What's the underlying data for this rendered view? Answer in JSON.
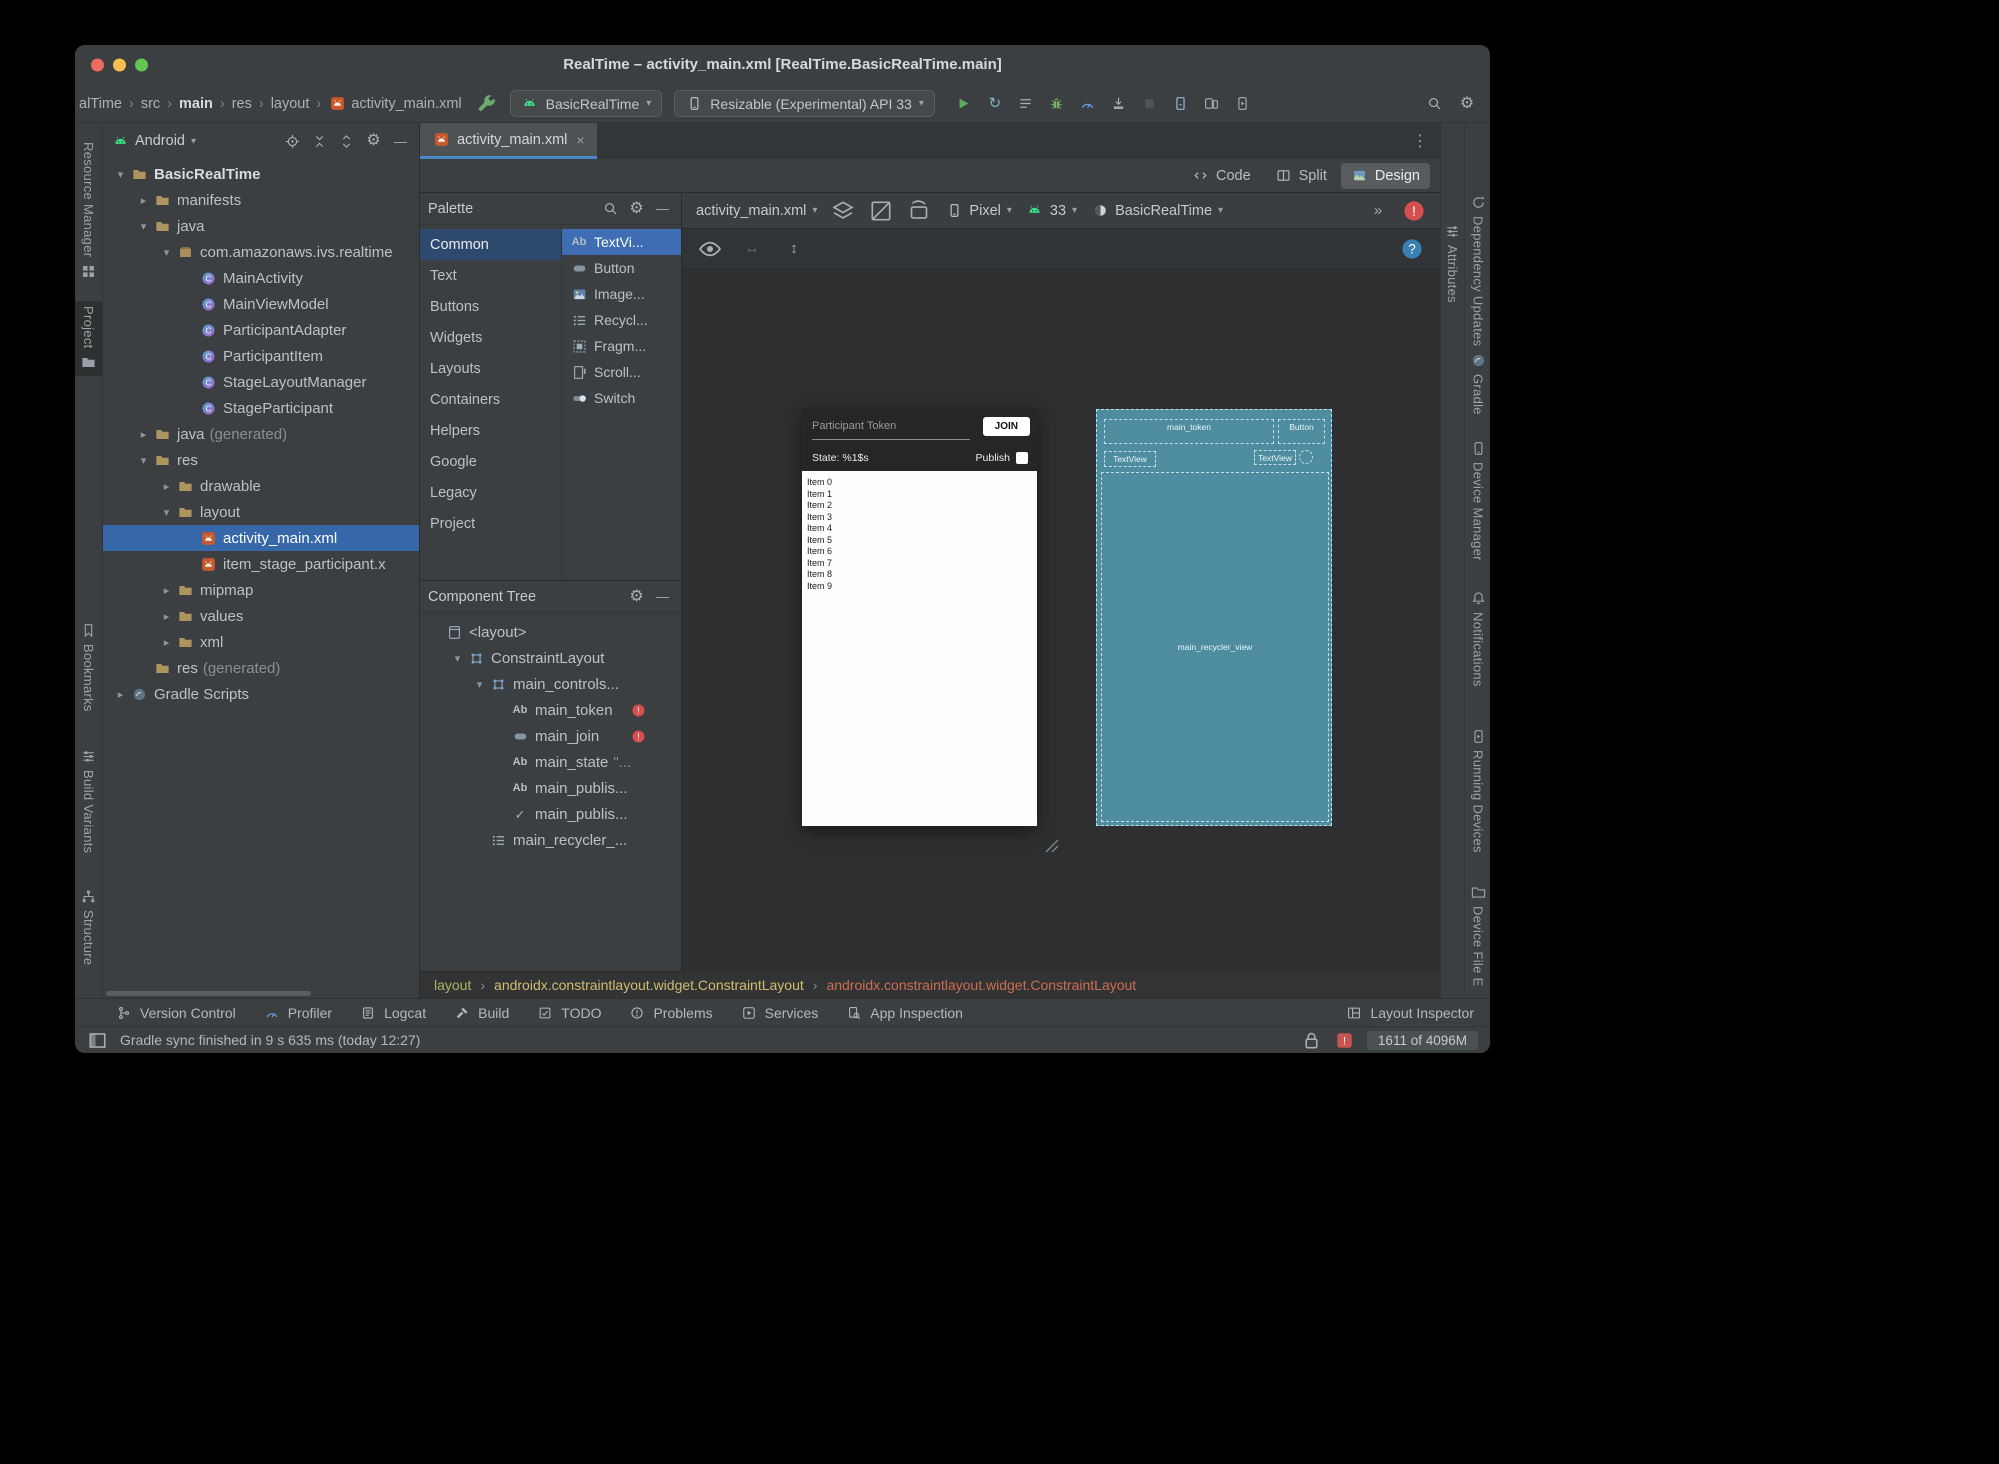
{
  "colors": {
    "selection_blue": "#3668a9",
    "palette_selection": "#3f6db4",
    "error_red": "#d64f4f",
    "run_green": "#5caa5f",
    "blueprint_teal": "#4e8ca0",
    "tab_underline": "#4a88c7"
  },
  "window": {
    "title": "RealTime – activity_main.xml [RealTime.BasicRealTime.main]"
  },
  "navbar": {
    "breadcrumbs": [
      "alTime",
      "src",
      "main",
      "res",
      "layout",
      "activity_main.xml"
    ],
    "run_config": "BasicRealTime",
    "device_selector": "Resizable (Experimental) API 33",
    "action_icons": [
      "run",
      "rerun",
      "run-configurations",
      "debug",
      "profiler",
      "attach-debugger",
      "stop",
      "device-manager",
      "mirror-device",
      "running-devices"
    ],
    "right_icons": [
      "search-everywhere",
      "settings"
    ]
  },
  "left_stripe": {
    "items": [
      {
        "label": "Resource Manager",
        "icon": "resource-manager"
      },
      {
        "label": "Project",
        "icon": "project-folder",
        "active": true
      },
      {
        "label": "Bookmarks",
        "icon": "bookmark"
      },
      {
        "label": "Build Variants",
        "icon": "build-variants"
      },
      {
        "label": "Structure",
        "icon": "structure"
      }
    ]
  },
  "right_stripe": {
    "attributes_tab": {
      "label": "Attributes",
      "icon": "attributes"
    },
    "items": [
      {
        "label": "Dependency Updates",
        "icon": "dependency-updates"
      },
      {
        "label": "Gradle",
        "icon": "gradle"
      },
      {
        "label": "Device Manager",
        "icon": "phone"
      },
      {
        "label": "Notifications",
        "icon": "notifications"
      },
      {
        "label": "Running Devices",
        "icon": "running-devices"
      },
      {
        "label": "Device File E",
        "icon": "device-file-explorer"
      }
    ]
  },
  "project_panel": {
    "view_selector": "Android",
    "header_icons": [
      "locate",
      "collapse-all",
      "expand-all",
      "settings",
      "hide"
    ],
    "tree": [
      {
        "label": "BasicRealTime",
        "icon": "folder",
        "indent": 0,
        "arrow": "down",
        "bold": true
      },
      {
        "label": "manifests",
        "icon": "folder",
        "indent": 1,
        "arrow": "right"
      },
      {
        "label": "java",
        "icon": "folder",
        "indent": 1,
        "arrow": "down"
      },
      {
        "label": "com.amazonaws.ivs.realtime",
        "icon": "package",
        "indent": 2,
        "arrow": "down"
      },
      {
        "label": "MainActivity",
        "icon": "class",
        "indent": 3
      },
      {
        "label": "MainViewModel",
        "icon": "class",
        "indent": 3
      },
      {
        "label": "ParticipantAdapter",
        "icon": "class",
        "indent": 3
      },
      {
        "label": "ParticipantItem",
        "icon": "class",
        "indent": 3
      },
      {
        "label": "StageLayoutManager",
        "icon": "class",
        "indent": 3
      },
      {
        "label": "StageParticipant",
        "icon": "class",
        "indent": 3
      },
      {
        "label": "java",
        "suffix": " (generated)",
        "icon": "folder",
        "indent": 1,
        "arrow": "right"
      },
      {
        "label": "res",
        "icon": "folder",
        "indent": 1,
        "arrow": "down"
      },
      {
        "label": "drawable",
        "icon": "folder",
        "indent": 2,
        "arrow": "right"
      },
      {
        "label": "layout",
        "icon": "folder",
        "indent": 2,
        "arrow": "down"
      },
      {
        "label": "activity_main.xml",
        "icon": "xml-file",
        "indent": 3,
        "selected": true
      },
      {
        "label": "item_stage_participant.x",
        "icon": "xml-file",
        "indent": 3
      },
      {
        "label": "mipmap",
        "icon": "folder",
        "indent": 2,
        "arrow": "right"
      },
      {
        "label": "values",
        "icon": "folder",
        "indent": 2,
        "arrow": "right"
      },
      {
        "label": "xml",
        "icon": "folder",
        "indent": 2,
        "arrow": "right"
      },
      {
        "label": "res",
        "suffix": " (generated)",
        "icon": "folder",
        "indent": 1
      },
      {
        "label": "Gradle Scripts",
        "icon": "gradle",
        "indent": 0,
        "arrow": "right"
      }
    ]
  },
  "editor": {
    "tab_title": "activity_main.xml",
    "modes": {
      "code": "Code",
      "split": "Split",
      "design": "Design"
    },
    "active_mode": "Design"
  },
  "palette": {
    "title": "Palette",
    "header_icons": [
      "search",
      "settings",
      "hide"
    ],
    "categories": [
      "Common",
      "Text",
      "Buttons",
      "Widgets",
      "Layouts",
      "Containers",
      "Helpers",
      "Google",
      "Legacy",
      "Project"
    ],
    "selected_category": "Common",
    "components": [
      {
        "label": "TextVi...",
        "icon": "textview",
        "selected": true
      },
      {
        "label": "Button",
        "icon": "button"
      },
      {
        "label": "Image...",
        "icon": "imageview"
      },
      {
        "label": "Recycl...",
        "icon": "recyclerview"
      },
      {
        "label": "Fragm...",
        "icon": "fragment"
      },
      {
        "label": "Scroll...",
        "icon": "scrollview"
      },
      {
        "label": "Switch",
        "icon": "switch"
      }
    ]
  },
  "component_tree": {
    "title": "Component Tree",
    "header_icons": [
      "settings",
      "hide"
    ],
    "items": [
      {
        "label": "<layout>",
        "icon": "layout-file",
        "indent": 0
      },
      {
        "label": "ConstraintLayout",
        "icon": "constraint-layout",
        "indent": 1,
        "arrow": "down"
      },
      {
        "label": "main_controls...",
        "icon": "constraint-layout",
        "indent": 2,
        "arrow": "down"
      },
      {
        "label": "main_token",
        "icon": "textview",
        "indent": 3,
        "error": true
      },
      {
        "label": "main_join",
        "icon": "button",
        "indent": 3,
        "error": true
      },
      {
        "label": "main_state",
        "suffix": "\"...",
        "icon": "textview",
        "indent": 3
      },
      {
        "label": "main_publis...",
        "icon": "textview",
        "indent": 3
      },
      {
        "label": "main_publis...",
        "icon": "checkbox",
        "indent": 3
      },
      {
        "label": "main_recycler_...",
        "icon": "recyclerview",
        "indent": 2
      }
    ]
  },
  "design_surface": {
    "file": "activity_main.xml",
    "device": "Pixel",
    "api_level": "33",
    "theme": "BasicRealTime"
  },
  "preview": {
    "token_hint": "Participant Token",
    "join_label": "JOIN",
    "state_text": "State: %1$s",
    "publish_label": "Publish",
    "list_items": [
      "Item 0",
      "Item 1",
      "Item 2",
      "Item 3",
      "Item 4",
      "Item 5",
      "Item 6",
      "Item 7",
      "Item 8",
      "Item 9"
    ]
  },
  "blueprint": {
    "token_id": "main_token",
    "button_label": "Button",
    "textview_label": "TextView",
    "textview2_label": "TextView",
    "recycler_id": "main_recycler_view"
  },
  "xml_breadcrumbs": [
    "layout",
    "androidx.constraintlayout.widget.ConstraintLayout",
    "androidx.constraintlayout.widget.ConstraintLayout"
  ],
  "bottom_bar": {
    "left": [
      {
        "label": "Version Control",
        "icon": "version-control"
      },
      {
        "label": "Profiler",
        "icon": "profiler"
      },
      {
        "label": "Logcat",
        "icon": "logcat"
      },
      {
        "label": "Build",
        "icon": "build"
      },
      {
        "label": "TODO",
        "icon": "todo"
      },
      {
        "label": "Problems",
        "icon": "problems"
      },
      {
        "label": "Services",
        "icon": "services"
      },
      {
        "label": "App Inspection",
        "icon": "app-inspection"
      }
    ],
    "right": [
      {
        "label": "Layout Inspector",
        "icon": "layout-inspector"
      }
    ]
  },
  "status_bar": {
    "message": "Gradle sync finished in 9 s 635 ms (today 12:27)",
    "memory": "1611 of 4096M"
  }
}
